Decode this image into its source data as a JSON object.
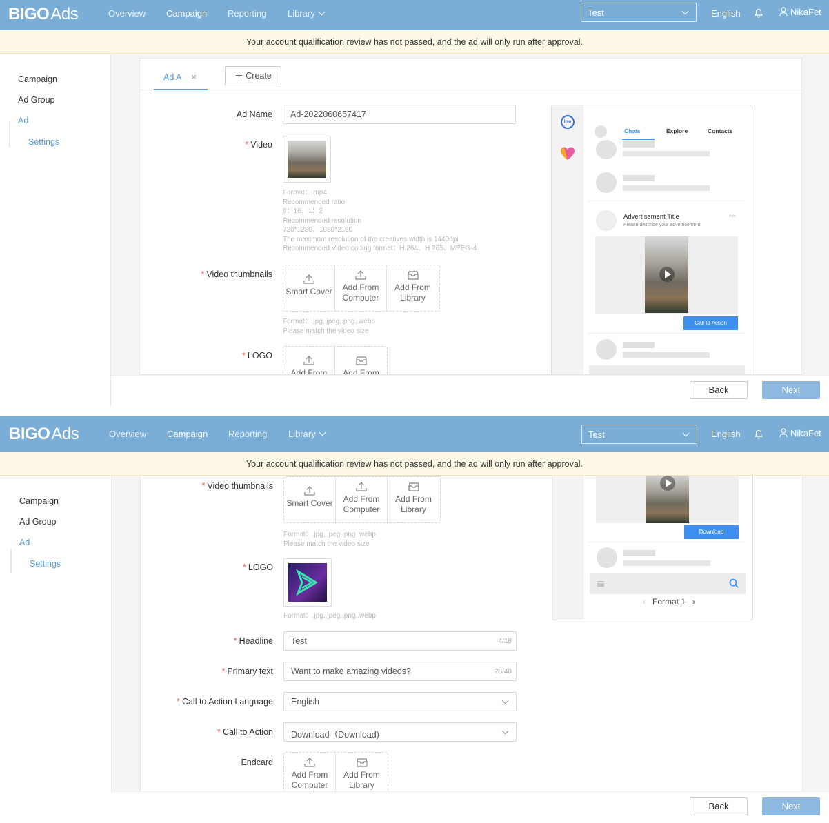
{
  "nav": {
    "logo_main": "BIGO",
    "logo_sub": "Ads",
    "links": [
      "Overview",
      "Campaign",
      "Reporting",
      "Library"
    ],
    "account": "Test",
    "language": "English",
    "user": "NikaFet"
  },
  "notice": "Your account qualification review has not passed, and the ad will only run after approval.",
  "sidebar": {
    "items": [
      "Campaign",
      "Ad Group",
      "Ad",
      "Settings"
    ]
  },
  "tabs": {
    "ad_tab": "Ad A",
    "close": "×",
    "create": "Create"
  },
  "form": {
    "ad_name_label": "Ad Name",
    "ad_name_value": "Ad-2022060657417",
    "video_label": "Video",
    "video_hints": [
      "Format：.mp4",
      "Recommended ratio",
      "9：16、1：2",
      "Recommended resolution",
      "720*1280、1080*2160",
      "The maximum resolution of the creatives width is 1440dpi",
      "Recommended Video coding format：H.264、H.265、MPEG-4"
    ],
    "thumbs_label": "Video thumbnails",
    "smart_cover": "Smart Cover",
    "add_from_computer": "Add From Computer",
    "add_from_library": "Add From Library",
    "add_from": "Add From",
    "thumb_hint1": "Format：.jpg,.jpeg,.png,.webp",
    "thumb_hint2": "Please match the video size",
    "logo_label": "LOGO",
    "logo_hint": "Format：.jpg,.jpeg,.png,.webp",
    "headline_label": "Headline",
    "headline_value": "Test",
    "headline_count": "4/18",
    "primary_label": "Primary text",
    "primary_value": "Want to make amazing videos?",
    "primary_count": "28/40",
    "cta_lang_label": "Call to Action Language",
    "cta_lang_value": "English",
    "cta_label": "Call to Action",
    "cta_value": "Download（Download)",
    "endcard_label": "Endcard"
  },
  "preview": {
    "app_label": "imo",
    "tabs": [
      "Chats",
      "Explore",
      "Contacts"
    ],
    "ad_title": "Advertisement Title",
    "ad_desc": "Please describe your advertisement",
    "ads_tag": "Ads",
    "cta_default": "Call to Action",
    "cta_download": "Download",
    "format": "Format 1"
  },
  "footer": {
    "back": "Back",
    "next": "Next"
  },
  "colors": {
    "nav": "#7aaed6",
    "accent": "#5b9dd9",
    "cta": "#3f8ff0",
    "required": "#e55555"
  }
}
